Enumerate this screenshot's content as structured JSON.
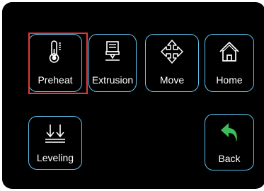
{
  "buttons": {
    "preheat": {
      "label": "Preheat",
      "icon": "thermometer-icon",
      "selected": true
    },
    "extrusion": {
      "label": "Extrusion",
      "icon": "extruder-icon"
    },
    "move": {
      "label": "Move",
      "icon": "move-arrows-icon"
    },
    "home": {
      "label": "Home",
      "icon": "home-icon"
    },
    "leveling": {
      "label": "Leveling",
      "icon": "leveling-icon"
    },
    "back": {
      "label": "Back",
      "icon": "back-arrow-icon"
    }
  },
  "colors": {
    "background": "#000000",
    "button_border": "#5ec3ee",
    "selection": "#e5393a",
    "back_arrow": "#3dbd5a",
    "text": "#ffffff"
  }
}
